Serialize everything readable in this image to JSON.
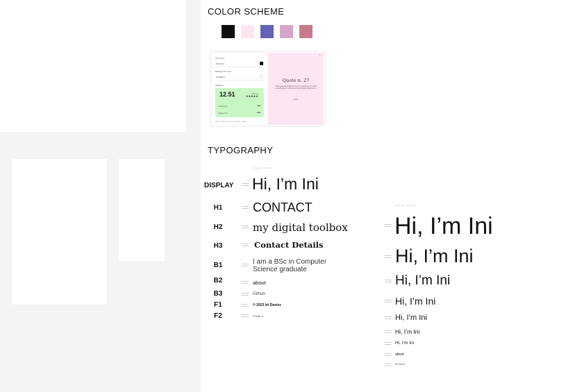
{
  "sections": {
    "color_scheme": "COLOR SCHEME",
    "typography": "TYPOGRAPHY"
  },
  "palette": [
    "#0d0d12",
    "#fde6f2",
    "#6461b7",
    "#d6a3cc",
    "#c67b8c"
  ],
  "preview": {
    "text_color_label": "Text color",
    "text_color_value": "#11121d",
    "bg_label": "Background color",
    "bg_value": "#FDE6F2",
    "stats_label": "Statistics",
    "score": "12.51",
    "rating_label": "Rating",
    "stars": "★★★★★",
    "small_font_label": "Small font",
    "large_font_label": "Large font",
    "dots": "●●●",
    "footnote": "Show sequence for sample quote",
    "quote_title": "Quote n. 27",
    "quote_body": "If the universe of literary forms is anything, it is most certainly kept in the lessons that history teaches us.",
    "quote_author": "Jane",
    "close_glyph": "×"
  },
  "typography": {
    "rows": [
      {
        "label": "DISPLAY",
        "sample": "Hi, I’m Ini"
      },
      {
        "label": "H1",
        "sample": "CONTACT"
      },
      {
        "label": "H2",
        "sample": "my digital toolbox"
      },
      {
        "label": "H3",
        "sample": "Contact Details"
      },
      {
        "label": "B1",
        "sample": "I am a BSc in Computer Science graduate"
      },
      {
        "label": "B2",
        "sample": "about"
      },
      {
        "label": "B3",
        "sample": "Github"
      },
      {
        "label": "F1",
        "sample": "© 2023 Ini Davies"
      },
      {
        "label": "F2",
        "sample": "Footer 2"
      }
    ],
    "scale_samples": [
      "Hi, I’m Ini",
      "Hi, I’m Ini",
      "Hi, I’m Ini",
      "Hi, I’m Ini",
      "Hi, I’m Ini",
      "Hi, I’m Ini",
      "Hi, I’m Ini",
      "about",
      "Hi, this is"
    ],
    "left_caption": "Reference · font list",
    "right_caption": "Reference · font scale"
  }
}
